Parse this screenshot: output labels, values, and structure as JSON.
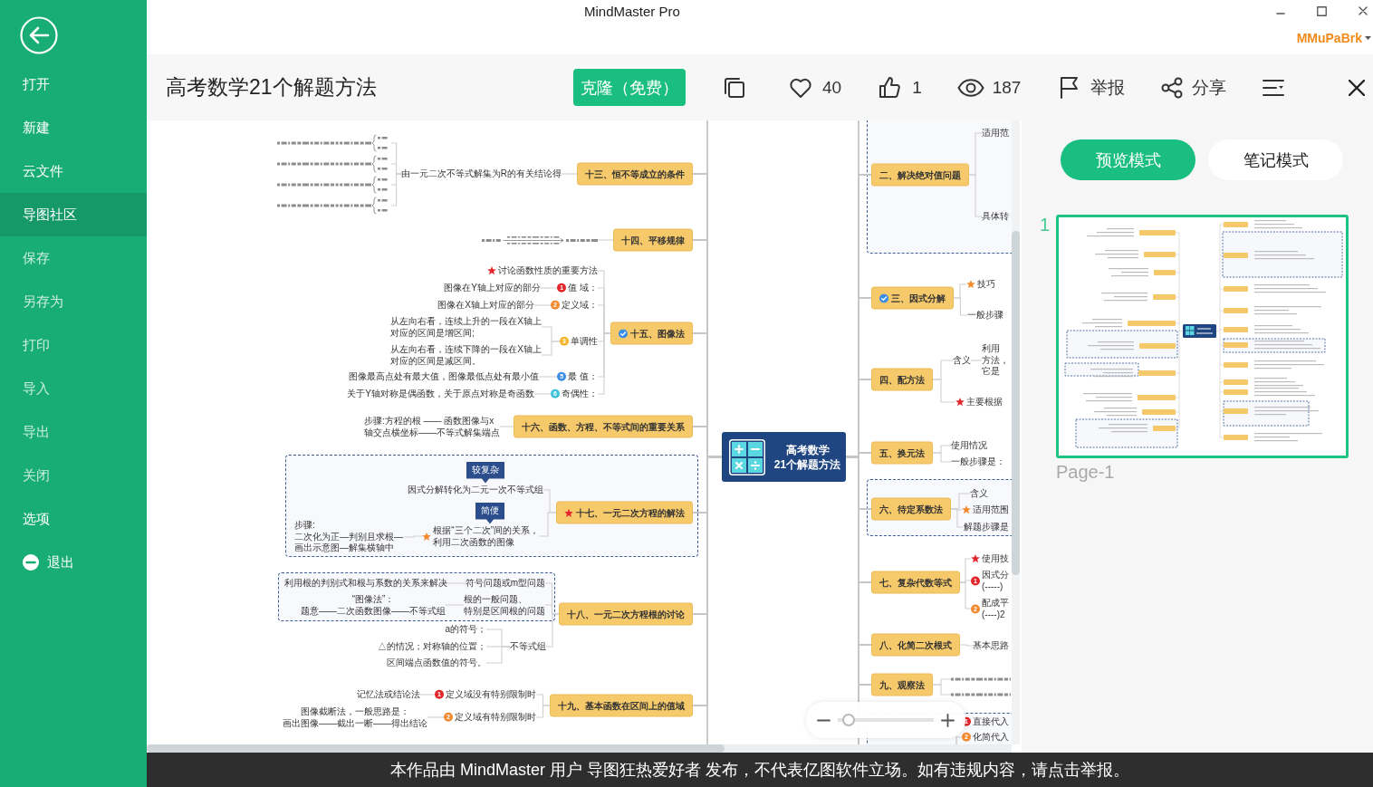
{
  "window": {
    "title": "MindMaster Pro",
    "user": "MMuPaBrk"
  },
  "sidebar": {
    "items": [
      {
        "label": "打开",
        "kind": "command",
        "selected": false,
        "disabled": false
      },
      {
        "label": "新建",
        "kind": "command",
        "selected": false,
        "disabled": false
      },
      {
        "label": "云文件",
        "kind": "command",
        "selected": false,
        "disabled": false
      },
      {
        "label": "导图社区",
        "kind": "command",
        "selected": true,
        "disabled": false
      },
      {
        "label": "保存",
        "kind": "command",
        "selected": false,
        "disabled": true
      },
      {
        "label": "另存为",
        "kind": "command",
        "selected": false,
        "disabled": true
      },
      {
        "label": "打印",
        "kind": "command",
        "selected": false,
        "disabled": true
      },
      {
        "label": "导入",
        "kind": "command",
        "selected": false,
        "disabled": true
      },
      {
        "label": "导出",
        "kind": "command",
        "selected": false,
        "disabled": true
      },
      {
        "label": "关闭",
        "kind": "command",
        "selected": false,
        "disabled": true
      },
      {
        "label": "选项",
        "kind": "command",
        "selected": false,
        "disabled": false
      },
      {
        "label": "退出",
        "kind": "exit",
        "selected": false,
        "disabled": false
      }
    ]
  },
  "document": {
    "title": "高考数学21个解题方法",
    "clone_button": "克隆（免费）",
    "like_count": "40",
    "thumbs_up_count": "1",
    "view_count": "187",
    "report": "举报",
    "share": "分享"
  },
  "mindmap": {
    "center": "高考数学\n21个解题方法",
    "left": [
      {
        "kind": "topic",
        "text": "十三、恒不等成立的条件",
        "children": [
          {
            "kind": "text",
            "text": "由一元二次不等式解集为R的有关结论得",
            "children": [
              {
                "kind": "formula"
              },
              {
                "kind": "formula"
              },
              {
                "kind": "formula"
              },
              {
                "kind": "formula"
              }
            ]
          }
        ]
      },
      {
        "kind": "topic",
        "text": "十四、平移规律",
        "children": [
          {
            "kind": "formula"
          }
        ]
      },
      {
        "kind": "topic",
        "text": "十五、图像法",
        "marker": {
          "kind": "check",
          "color": "#3a8ee6"
        },
        "children": [
          {
            "kind": "text",
            "text": "讨论函数性质的重要方法",
            "marker": {
              "kind": "star",
              "color": "#e3262b"
            }
          },
          {
            "kind": "text",
            "text": "值 域：",
            "marker": {
              "kind": "priority",
              "label": "1",
              "color": "#e3262b"
            },
            "children": [
              {
                "kind": "text",
                "text": "图像在Y轴上对应的部分"
              }
            ]
          },
          {
            "kind": "text",
            "text": "定义域：",
            "marker": {
              "kind": "priority",
              "label": "2",
              "color": "#f28a30"
            },
            "children": [
              {
                "kind": "text",
                "text": "图像在X轴上对应的部分"
              }
            ]
          },
          {
            "kind": "text",
            "text": "单调性",
            "marker": {
              "kind": "priority",
              "label": "3",
              "color": "#f6b428"
            },
            "children": [
              {
                "kind": "text",
                "text": "从左向右看，连续上升的一段在X轴上对应的区间是增区间;"
              },
              {
                "kind": "text",
                "text": "从左向右看，连续下降的一段在X轴上对应的区间是减区间。"
              }
            ]
          },
          {
            "kind": "text",
            "text": "最 值：",
            "marker": {
              "kind": "priority",
              "label": "5",
              "color": "#3a8ee6"
            },
            "children": [
              {
                "kind": "text",
                "text": "图像最高点处有最大值，图像最低点处有最小值"
              }
            ]
          },
          {
            "kind": "text",
            "text": "奇偶性：",
            "marker": {
              "kind": "priority",
              "label": "6",
              "color": "#3ec3da"
            },
            "children": [
              {
                "kind": "text",
                "text": "关于Y轴对称是偶函数，关于原点对称是奇函数"
              }
            ]
          }
        ]
      },
      {
        "kind": "topic",
        "text": "十六、函数、方程、不等式间的重要关系",
        "children": [
          {
            "kind": "text",
            "text": "步骤:方程的根 —— 函数图像与x轴交点横坐标——不等式解集端点"
          }
        ]
      },
      {
        "kind": "topic",
        "text": "十七、一元二次方程的解法",
        "marker": {
          "kind": "star",
          "color": "#e3262b"
        },
        "boundary": true,
        "children": [
          {
            "kind": "text",
            "text": "因式分解转化为二元一次不等式组",
            "callout": "较复杂"
          },
          {
            "kind": "text",
            "text": "根据“三个二次”间的关系，利用二次函数的图像",
            "marker": {
              "kind": "star",
              "color": "#f28a30"
            },
            "callout": "简便",
            "children": [
              {
                "kind": "text",
                "text": "步骤:二次化为正—判别且求根—画出示意图—解集横轴中"
              }
            ]
          }
        ]
      },
      {
        "kind": "topic",
        "text": "十八、一元二次方程根的讨论",
        "boundary": true,
        "children": [
          {
            "kind": "text",
            "text": "符号问题或m型问题",
            "children": [
              {
                "kind": "text",
                "text": "利用根的判别式和根与系数的关系来解决"
              }
            ]
          },
          {
            "kind": "text",
            "text": "根的一般问题、特别是区间根的问题",
            "children": [
              {
                "kind": "text",
                "text": "“图像法”：题意——二次函数图像——不等式组"
              }
            ]
          },
          {
            "kind": "text",
            "text": "不等式组",
            "children": [
              {
                "kind": "text",
                "text": "a的符号；"
              },
              {
                "kind": "text",
                "text": "△的情况；对称轴的位置；"
              },
              {
                "kind": "text",
                "text": "区间端点函数值的符号。"
              }
            ]
          }
        ]
      },
      {
        "kind": "topic",
        "text": "十九、基本函数在区间上的值域",
        "children": [
          {
            "kind": "text",
            "text": "定义域没有特别限制时",
            "marker": {
              "kind": "priority",
              "label": "1",
              "color": "#e3262b"
            },
            "children": [
              {
                "kind": "text",
                "text": "记忆法或结论法"
              }
            ]
          },
          {
            "kind": "text",
            "text": "定义域有特别限制时",
            "marker": {
              "kind": "priority",
              "label": "2",
              "color": "#f28a30"
            },
            "children": [
              {
                "kind": "text",
                "text": "图像截断法，一般思路是：画出图像——截出一断——得出结论"
              }
            ]
          }
        ]
      }
    ],
    "right": [
      {
        "kind": "topic",
        "text": "二、解决绝对值问题",
        "boundary": true,
        "children": [
          {
            "kind": "text",
            "text": "适用范"
          },
          {
            "kind": "text",
            "text": "具体转"
          }
        ]
      },
      {
        "kind": "topic",
        "text": "三、因式分解",
        "marker": {
          "kind": "check",
          "color": "#3a8ee6"
        },
        "children": [
          {
            "kind": "text",
            "text": "技巧",
            "marker": {
              "kind": "star",
              "color": "#f28a30"
            }
          },
          {
            "kind": "text",
            "text": "一般步骤"
          }
        ]
      },
      {
        "kind": "topic",
        "text": "四、配方法",
        "children": [
          {
            "kind": "text",
            "text": "含义",
            "children": [
              {
                "kind": "text",
                "text": "利用方法，它是"
              }
            ]
          },
          {
            "kind": "text",
            "text": "主要根据",
            "marker": {
              "kind": "star",
              "color": "#e3262b"
            }
          }
        ]
      },
      {
        "kind": "topic",
        "text": "五、换元法",
        "children": [
          {
            "kind": "text",
            "text": "使用情况"
          },
          {
            "kind": "text",
            "text": "一般步骤是："
          }
        ]
      },
      {
        "kind": "topic",
        "text": "六、待定系数法",
        "boundary": true,
        "children": [
          {
            "kind": "text",
            "text": "含义"
          },
          {
            "kind": "text",
            "text": "适用范围",
            "marker": {
              "kind": "star",
              "color": "#f28a30"
            }
          },
          {
            "kind": "text",
            "text": "解题步骤是"
          }
        ]
      },
      {
        "kind": "topic",
        "text": "七、复杂代数等式",
        "children": [
          {
            "kind": "text",
            "text": "使用技",
            "marker": {
              "kind": "star",
              "color": "#e3262b"
            }
          },
          {
            "kind": "text",
            "text": "因式分\n(-----)",
            "marker": {
              "kind": "priority",
              "label": "1",
              "color": "#e3262b"
            }
          },
          {
            "kind": "text",
            "text": "配成平\n(----)2",
            "marker": {
              "kind": "priority",
              "label": "2",
              "color": "#f28a30"
            }
          }
        ]
      },
      {
        "kind": "topic",
        "text": "八、化简二次根式",
        "children": [
          {
            "kind": "text",
            "text": "基本思路"
          }
        ]
      },
      {
        "kind": "topic",
        "text": "九、观察法",
        "children": [
          {
            "kind": "formula"
          },
          {
            "kind": "formula"
          }
        ]
      },
      {
        "kind": "topic",
        "boundary": true,
        "children": [
          {
            "kind": "text",
            "text": "直接代入",
            "marker": {
              "kind": "priority",
              "label": "1",
              "color": "#e3262b"
            }
          },
          {
            "kind": "text",
            "text": "化简代入",
            "marker": {
              "kind": "priority",
              "label": "2",
              "color": "#f28a30"
            }
          }
        ]
      }
    ],
    "zoom": {
      "level": 0.05
    }
  },
  "preview": {
    "modes": [
      {
        "label": "预览模式",
        "selected": true
      },
      {
        "label": "笔记模式",
        "selected": false
      }
    ],
    "pages": [
      {
        "number": "1",
        "label": "Page-1",
        "selected": true
      }
    ]
  },
  "footer": "本作品由 MindMaster 用户 导图狂热爱好者 发布，不代表亿图软件立场。如有违规内容，请点击举报。"
}
